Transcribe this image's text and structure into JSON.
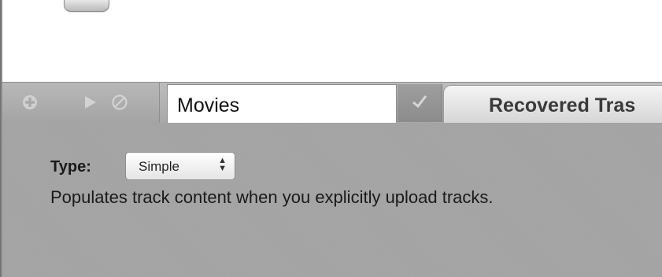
{
  "toolbar": {
    "add_icon": "add-circle-icon",
    "play_icon": "play-icon",
    "stop_icon": "stop-circle-icon"
  },
  "playlist": {
    "name_value": "Movies",
    "confirm_icon": "checkmark-icon"
  },
  "tabs": {
    "recovered_label": "Recovered Tras"
  },
  "settings": {
    "type_label": "Type:",
    "type_value": "Simple",
    "description": "Populates track content when you explicitly upload tracks."
  },
  "colors": {
    "panel_gray": "#a3a3a3",
    "tabbar_gray": "#b2b2b2"
  }
}
